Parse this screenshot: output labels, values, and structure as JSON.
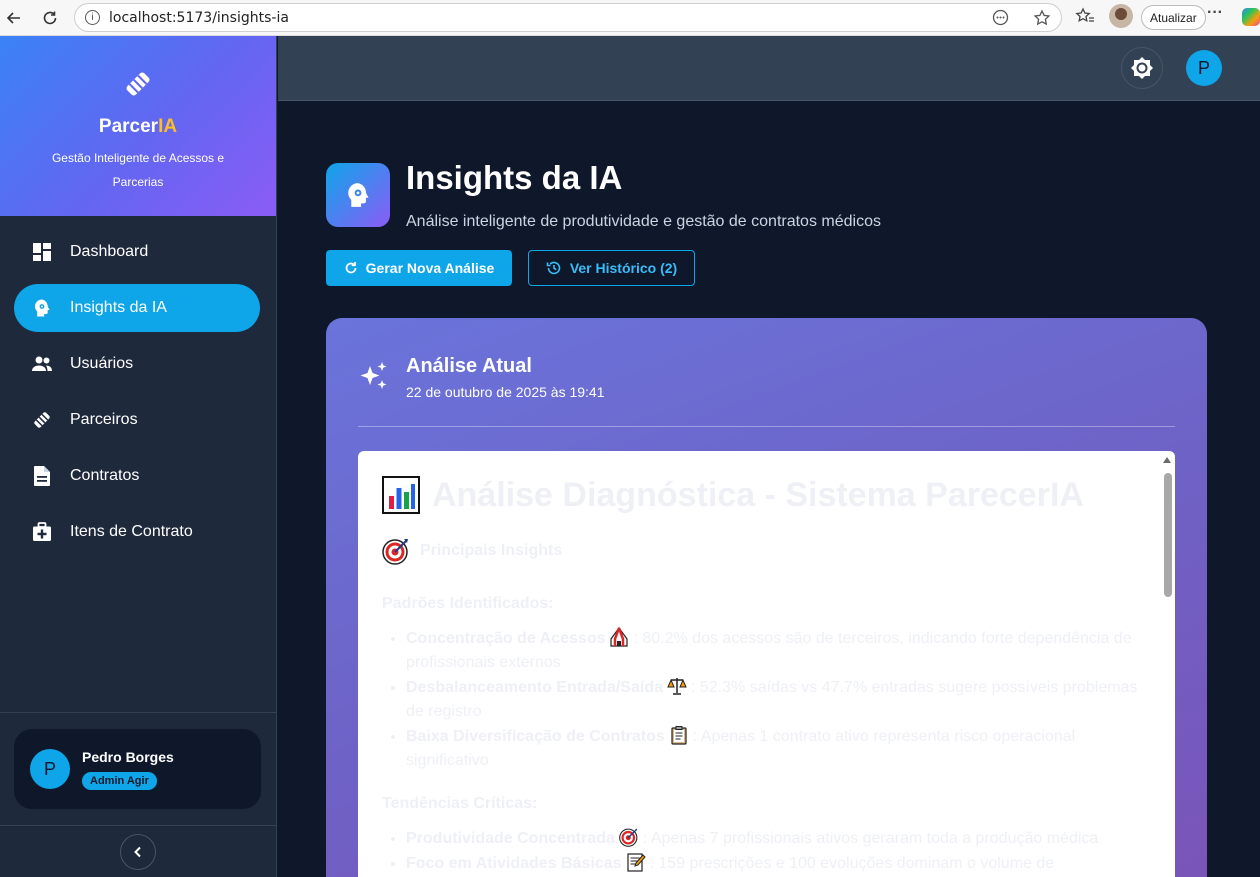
{
  "browser": {
    "url": "localhost:5173/insights-ia",
    "update_label": "Atualizar"
  },
  "brand": {
    "name_main": "Parcer",
    "name_accent": "IA",
    "subtitle": "Gestão Inteligente de Acessos e Parcerias"
  },
  "sidebar": {
    "items": [
      {
        "label": "Dashboard",
        "icon": "dashboard-icon"
      },
      {
        "label": "Insights da IA",
        "icon": "psychology-icon",
        "active": true
      },
      {
        "label": "Usuários",
        "icon": "users-icon"
      },
      {
        "label": "Parceiros",
        "icon": "handshake-icon"
      },
      {
        "label": "Contratos",
        "icon": "document-icon"
      },
      {
        "label": "Itens de Contrato",
        "icon": "medical-kit-icon"
      }
    ],
    "user": {
      "initial": "P",
      "name": "Pedro Borges",
      "role": "Admin Agir"
    }
  },
  "topbar": {
    "avatar_initial": "P"
  },
  "page": {
    "title": "Insights da IA",
    "subtitle": "Análise inteligente de produtividade e gestão de contratos médicos",
    "primary_button": "Gerar Nova Análise",
    "history_button": "Ver Histórico (2)"
  },
  "analysis": {
    "title": "Análise Atual",
    "date": "22 de outubro de 2025 às 19:41",
    "doc": {
      "h1": "Análise Diagnóstica - Sistema ParecerIA",
      "section": "Principais Insights",
      "patterns_title": "Padrões Identificados:",
      "patterns": [
        {
          "bold": "Concentração de Acessos",
          "text": ": 80.2% dos acessos são de terceiros, indicando forte dependência de profissionais externos"
        },
        {
          "bold": "Desbalanceamento Entrada/Saída",
          "text": ": 52.3% saídas vs 47.7% entradas sugere possíveis problemas de registro"
        },
        {
          "bold": "Baixa Diversificação de Contratos",
          "text": ": Apenas 1 contrato ativo representa risco operacional significativo"
        }
      ],
      "trends_title": "Tendências Críticas:",
      "trends": [
        {
          "bold": "Produtividade Concentrada",
          "text": ": Apenas 7 profissionais ativos geraram toda a produção médica"
        },
        {
          "bold": "Foco em Atividades Básicas",
          "text": ": 159 prescrições e 100 evoluções dominam o volume de"
        }
      ]
    }
  },
  "colors": {
    "accent": "#0ea5e9",
    "sidebar_bg": "#1e293b",
    "main_bg": "#0f172a",
    "brand_gold": "#fbbf24"
  }
}
